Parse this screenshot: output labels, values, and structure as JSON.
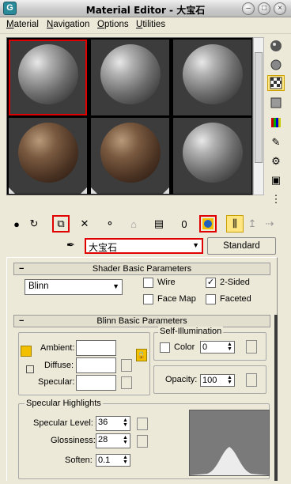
{
  "window": {
    "title": "Material Editor - 大宝石"
  },
  "menu": {
    "items": [
      {
        "label": "Material",
        "u": "M",
        "rest": "aterial"
      },
      {
        "label": "Navigation",
        "u": "N",
        "rest": "avigation"
      },
      {
        "label": "Options",
        "u": "O",
        "rest": "ptions"
      },
      {
        "label": "Utilities",
        "u": "U",
        "rest": "tilities"
      }
    ]
  },
  "material": {
    "name": "大宝石",
    "type_button": "Standard"
  },
  "shader_basic": {
    "header": "Shader Basic Parameters",
    "shader": "Blinn",
    "wire": {
      "label": "Wire",
      "checked": false
    },
    "two_sided": {
      "label": "2-Sided",
      "checked": true
    },
    "face_map": {
      "label": "Face Map",
      "checked": false
    },
    "faceted": {
      "label": "Faceted",
      "checked": false
    }
  },
  "blinn_basic": {
    "header": "Blinn Basic Parameters",
    "ambient_label": "Ambient:",
    "diffuse_label": "Diffuse:",
    "specular_label": "Specular:",
    "self_illum": {
      "group": "Self-Illumination",
      "color_label": "Color",
      "value": "0"
    },
    "opacity": {
      "label": "Opacity:",
      "value": "100"
    }
  },
  "specular_highlights": {
    "group": "Specular Highlights",
    "level": {
      "label": "Specular Level:",
      "value": "36"
    },
    "glossiness": {
      "label": "Glossiness:",
      "value": "28"
    },
    "soften": {
      "label": "Soften:",
      "value": "0.1"
    }
  },
  "icons": {
    "right_toolbar": [
      "sample-type-sphere-icon",
      "backlight-icon",
      "background-checker-icon",
      "sample-uv-tiling-icon",
      "video-color-check-icon",
      "make-preview-icon",
      "options-icon",
      "select-by-material-icon",
      "material-map-navigator-icon"
    ],
    "horizontal_toolbar": [
      "get-material-icon",
      "put-to-scene-icon",
      "assign-to-selection-icon",
      "reset-map-icon",
      "make-copy-icon",
      "make-unique-icon",
      "put-to-library-icon",
      "material-id-channel-icon",
      "show-map-in-viewport-icon",
      "show-end-result-icon",
      "go-to-parent-icon",
      "go-forward-to-sibling-icon"
    ]
  }
}
